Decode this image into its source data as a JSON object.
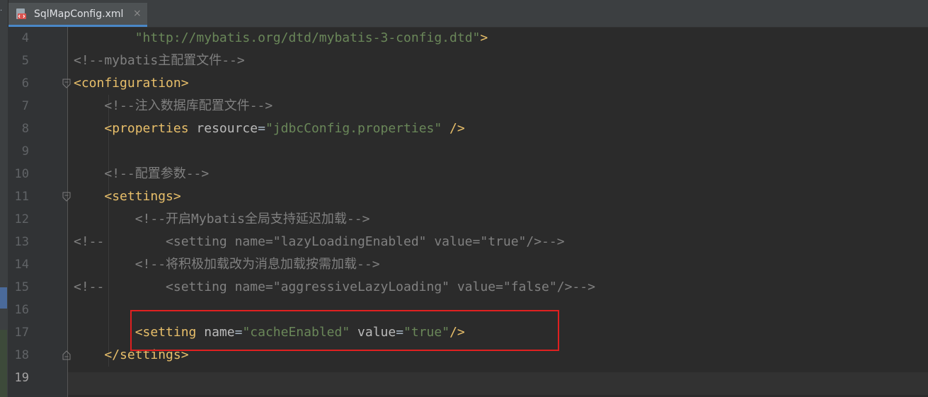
{
  "tab": {
    "filename": "SqlMapConfig.xml",
    "close_glyph": "×",
    "icon": "xml-file-icon"
  },
  "editor": {
    "current_line": 19,
    "lines": [
      {
        "n": "4",
        "segments": [
          {
            "t": "        ",
            "c": ""
          },
          {
            "t": "\"http://mybatis.org/dtd/mybatis-3-config.dtd\"",
            "c": "c-dtd"
          },
          {
            "t": ">",
            "c": "c-tag"
          }
        ]
      },
      {
        "n": "5",
        "segments": [
          {
            "t": "<!--mybatis主配置文件-->",
            "c": "c-comment"
          }
        ]
      },
      {
        "n": "6",
        "segments": [
          {
            "t": "<configuration>",
            "c": "c-tag"
          }
        ]
      },
      {
        "n": "7",
        "segments": [
          {
            "t": "    ",
            "c": ""
          },
          {
            "t": "<!--注入数据库配置文件-->",
            "c": "c-comment"
          }
        ]
      },
      {
        "n": "8",
        "segments": [
          {
            "t": "    ",
            "c": ""
          },
          {
            "t": "<properties ",
            "c": "c-tag"
          },
          {
            "t": "resource",
            "c": "c-attr"
          },
          {
            "t": "=",
            "c": "c-eq"
          },
          {
            "t": "\"jdbcConfig.properties\"",
            "c": "c-str"
          },
          {
            "t": " />",
            "c": "c-tag"
          }
        ]
      },
      {
        "n": "9",
        "segments": []
      },
      {
        "n": "10",
        "segments": [
          {
            "t": "    ",
            "c": ""
          },
          {
            "t": "<!--配置参数-->",
            "c": "c-comment"
          }
        ]
      },
      {
        "n": "11",
        "segments": [
          {
            "t": "    ",
            "c": ""
          },
          {
            "t": "<settings>",
            "c": "c-tag"
          }
        ]
      },
      {
        "n": "12",
        "segments": [
          {
            "t": "        ",
            "c": ""
          },
          {
            "t": "<!--开启Mybatis全局支持延迟加载-->",
            "c": "c-comment"
          }
        ]
      },
      {
        "n": "13",
        "segments": [
          {
            "t": "<!--        <setting name=\"lazyLoadingEnabled\" value=\"true\"/>-->",
            "c": "c-comment"
          }
        ]
      },
      {
        "n": "14",
        "segments": [
          {
            "t": "        ",
            "c": ""
          },
          {
            "t": "<!--将积极加载改为消息加载按需加载-->",
            "c": "c-comment"
          }
        ]
      },
      {
        "n": "15",
        "segments": [
          {
            "t": "<!--        <setting name=\"aggressiveLazyLoading\" value=\"false\"/>-->",
            "c": "c-comment"
          }
        ]
      },
      {
        "n": "16",
        "segments": []
      },
      {
        "n": "17",
        "segments": [
          {
            "t": "        ",
            "c": ""
          },
          {
            "t": "<setting ",
            "c": "c-tag"
          },
          {
            "t": "name",
            "c": "c-attr"
          },
          {
            "t": "=",
            "c": "c-eq"
          },
          {
            "t": "\"cacheEnabled\"",
            "c": "c-str"
          },
          {
            "t": " ",
            "c": ""
          },
          {
            "t": "value",
            "c": "c-attr"
          },
          {
            "t": "=",
            "c": "c-eq"
          },
          {
            "t": "\"true\"",
            "c": "c-str"
          },
          {
            "t": "/>",
            "c": "c-tag"
          }
        ]
      },
      {
        "n": "18",
        "segments": [
          {
            "t": "    ",
            "c": ""
          },
          {
            "t": "</settings>",
            "c": "c-tag"
          }
        ]
      },
      {
        "n": "19",
        "segments": []
      }
    ]
  },
  "colors": {
    "background": "#2b2b2b",
    "tag": "#e8bf6a",
    "string": "#6a8759",
    "comment": "#808080",
    "highlight_box": "#e02020"
  }
}
